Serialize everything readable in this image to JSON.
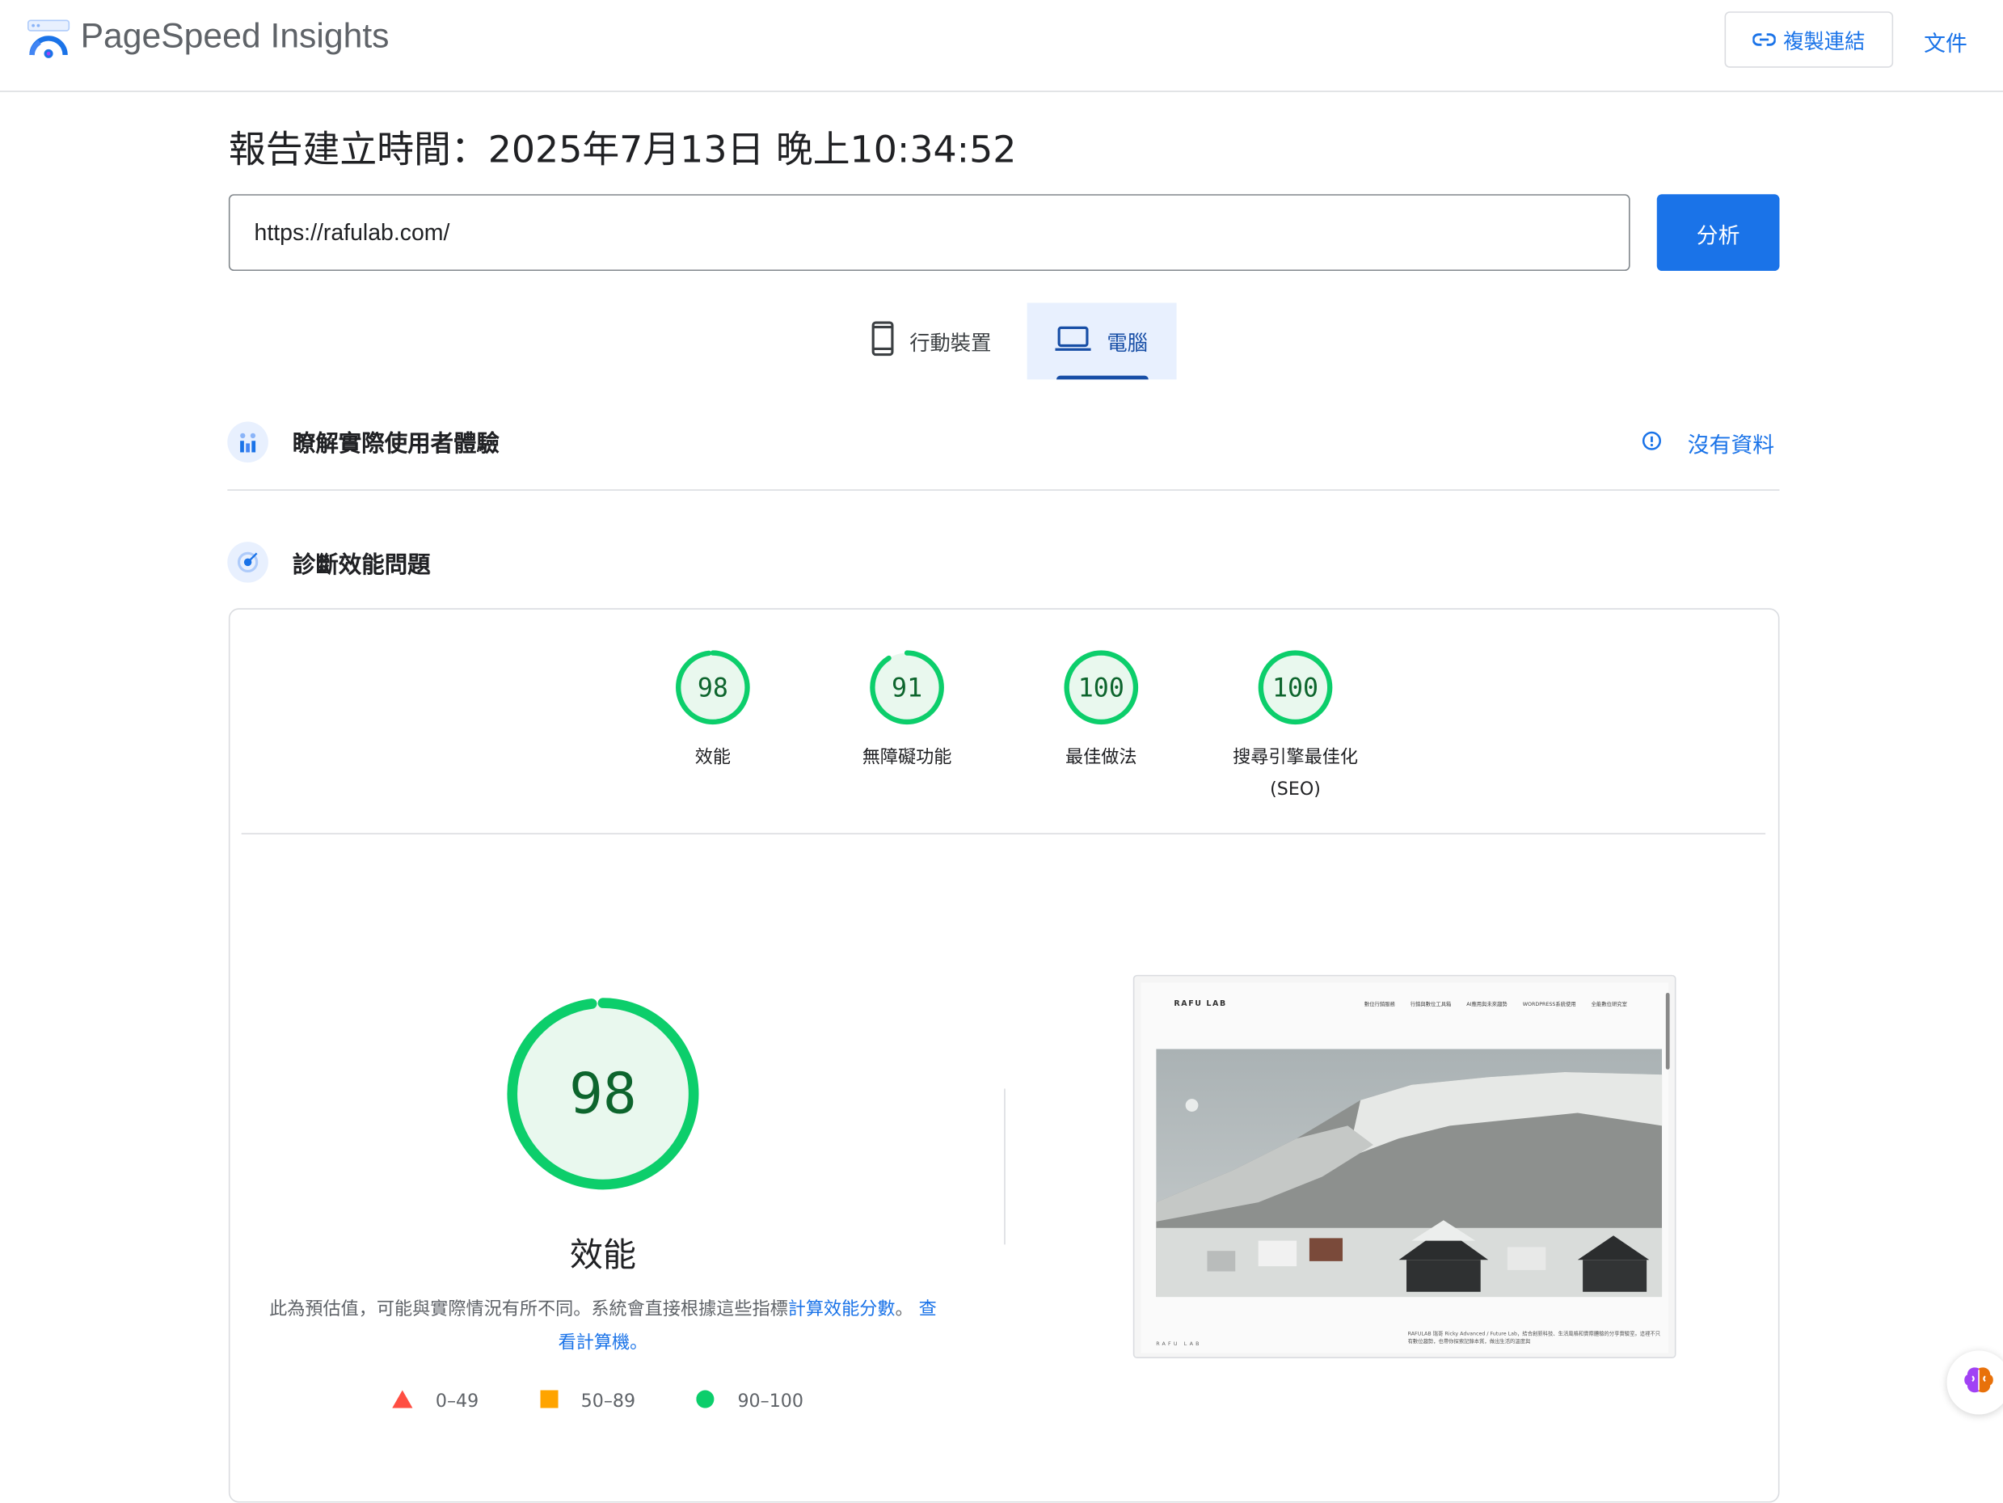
{
  "header": {
    "app_title": "PageSpeed Insights",
    "copy_link_label": "複製連結",
    "docs_label": "文件"
  },
  "report": {
    "created_time": "報告建立時間：2025年7月13日 晚上10:34:52",
    "url_value": "https://rafulab.com/",
    "analyze_label": "分析"
  },
  "device_tabs": [
    {
      "label": "行動裝置",
      "icon": "phone-icon",
      "selected": false
    },
    {
      "label": "電腦",
      "icon": "laptop-icon",
      "selected": true
    }
  ],
  "crux_section": {
    "title": "瞭解實際使用者體驗",
    "status": "沒有資料"
  },
  "diagnose_section": {
    "title": "診斷效能問題"
  },
  "scores": [
    {
      "value": "98",
      "label": "效能",
      "fraction": 0.98
    },
    {
      "value": "91",
      "label": "無障礙功能",
      "fraction": 0.91
    },
    {
      "value": "100",
      "label": "最佳做法",
      "fraction": 1.0
    },
    {
      "value": "100",
      "label": "搜尋引擎最佳化",
      "label2": "(SEO)",
      "fraction": 1.0
    }
  ],
  "performance": {
    "score": "98",
    "fraction": 0.98,
    "label": "效能",
    "desc_text": "此為預估值，可能與實際情況有所不同。系統會直接根據這些指標",
    "desc_link1": "計算效能分數",
    "desc_sep": "。",
    "desc_link2": "查看計算機。"
  },
  "legend": [
    {
      "range": "0–49",
      "shape": "triangle",
      "color": "#ff4e42"
    },
    {
      "range": "50–89",
      "shape": "square",
      "color": "#ffa400"
    },
    {
      "range": "90–100",
      "shape": "circle",
      "color": "#0cce6b"
    }
  ],
  "thumbnail": {
    "logo": "RAFU LAB",
    "nav": [
      "數位行銷服務",
      "行銷與數位工具箱",
      "AI應用與未來趨勢",
      "WORDPRESS系統使用",
      "全能數位研究室"
    ],
    "footer_logo": "RAFU LAB",
    "footer_text": "RAFULAB 瑞哥 Ricky Advanced / Future Lab，結合創新科技、生活風格和實際體驗的分享實驗室。這裡不只有數位趨勢，也帶你探索記錄本質，做出生活的溫度與"
  },
  "colors": {
    "accent": "#1a73e8",
    "pass": "#0cce6b",
    "pass_text": "#0d652d",
    "pass_fill": "#e9f8ee"
  }
}
